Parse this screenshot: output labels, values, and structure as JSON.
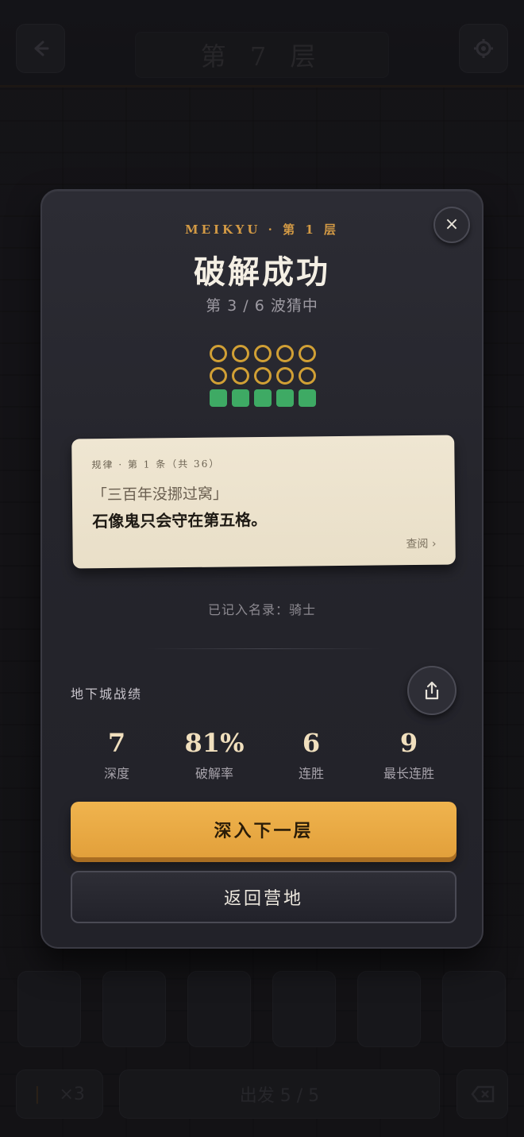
{
  "background": {
    "back_icon": "arrow-left-icon",
    "settings_icon": "gear-icon",
    "floor_title": "第 7 层",
    "torch_count": "×3",
    "depart_label": "出发 5 / 5",
    "delete_icon": "backspace-icon"
  },
  "modal": {
    "eyebrow": "MEIKYU · 第 1 层",
    "title": "破解成功",
    "subtitle": "第 3 / 6 波猜中",
    "close_label": "×",
    "guess_grid": [
      [
        "ring",
        "ring",
        "ring",
        "ring",
        "ring"
      ],
      [
        "ring",
        "ring",
        "ring",
        "ring",
        "ring"
      ],
      [
        "green",
        "green",
        "green",
        "green",
        "green"
      ]
    ],
    "rule_card": {
      "meta": "规律 · 第 1 条（共 36）",
      "quote": "「三百年没挪过窝」",
      "body": "石像鬼只会守在第五格。",
      "link": "查阅 ›"
    },
    "record": "已记入名录：骑士",
    "stats_title": "地下城战绩",
    "share_icon": "share-icon",
    "stats": [
      {
        "value": "7",
        "label": "深度"
      },
      {
        "value": "81%",
        "label": "破解率"
      },
      {
        "value": "6",
        "label": "连胜"
      },
      {
        "value": "9",
        "label": "最长连胜"
      }
    ],
    "primary_button": "深入下一层",
    "secondary_button": "返回营地"
  },
  "colors": {
    "accent_gold": "#d39a45",
    "ring": "#d1a035",
    "success_green": "#3eaa64",
    "primary_button": "#f0b44e"
  }
}
